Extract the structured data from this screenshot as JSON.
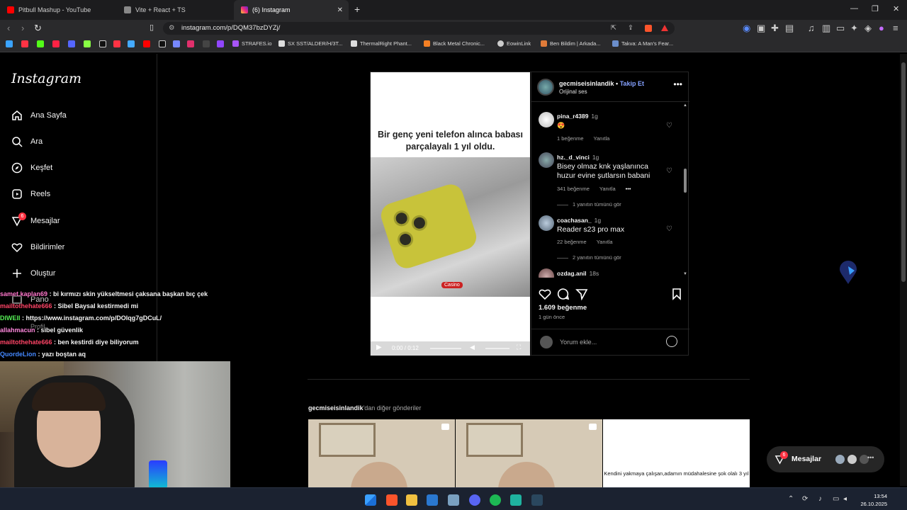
{
  "browser": {
    "tabs": [
      {
        "label": "Pitbull Mashup - YouTube",
        "color": "#ff0000"
      },
      {
        "label": "Vite + React + TS",
        "color": "#888888"
      },
      {
        "label": "(6) Instagram",
        "color": "#e1306c"
      }
    ],
    "new_tab": "+",
    "url": "instagram.com/p/DQM37bzDYZj/",
    "bookmarks": [
      {
        "label": "STRAFES.io"
      },
      {
        "label": "SX SST/ALDER/H/3T..."
      },
      {
        "label": "ThermalRight Phant..."
      },
      {
        "label": "Black Metal Chronic..."
      },
      {
        "label": "EowinLink"
      },
      {
        "label": "Ben Bildim | Arkada..."
      },
      {
        "label": "Takva: A Man's Fear..."
      }
    ]
  },
  "sidebar": {
    "logo": "Instagram",
    "items": [
      {
        "label": "Ana Sayfa",
        "icon": "home-icon"
      },
      {
        "label": "Ara",
        "icon": "search-icon"
      },
      {
        "label": "Keşfet",
        "icon": "explore-icon"
      },
      {
        "label": "Reels",
        "icon": "reels-icon"
      },
      {
        "label": "Mesajlar",
        "icon": "messenger-icon",
        "badge": "6"
      },
      {
        "label": "Bildirimler",
        "icon": "heart-icon"
      },
      {
        "label": "Oluştur",
        "icon": "plus-icon"
      },
      {
        "label": "Pano",
        "icon": "dashboard-icon"
      },
      {
        "label": "Profil",
        "icon": "profile-icon"
      }
    ]
  },
  "chat": [
    {
      "user": "samet.kaplan69",
      "text": ": bi kırmızı skin yükseltmesi çaksana başkan bıç çek",
      "color": "#ff77cc"
    },
    {
      "user": "mailtothehate666",
      "text": ": Sibel Baysal kestirmedi mi",
      "color": "#ff4466"
    },
    {
      "user": "DIWEII",
      "text": ": https://www.instagram.com/p/DOlqg7gDCuL/",
      "color": "#55ee55"
    },
    {
      "user": "allahmacun",
      "text": ": sibel güvenlik",
      "color": "#ff88dd"
    },
    {
      "user": "mailtothehate666",
      "text": ": ben kestirdi diye biliyorum",
      "color": "#ff4466"
    },
    {
      "user": "QuordeLion",
      "text": ": yazı boştan aq",
      "color": "#4488ff"
    }
  ],
  "post": {
    "caption": "Bir genç yeni telefon alınca babası parçalayalı 1 yıl oldu.",
    "casino_tag": "Casino",
    "video_time": "0:00 / 0:12",
    "username": "gecmiseisinlandik",
    "separator": " • ",
    "follow": "Takip Et",
    "audio": "Orijinal ses",
    "comments": [
      {
        "user": "pina_r4389",
        "time": "1g",
        "text": "😍",
        "likes": "1 beğenme",
        "reply": "Yanıtla",
        "replies": ""
      },
      {
        "user": "hz._d_vinci",
        "time": "1g",
        "text": "Bisey olmaz knk yaşlanınca huzur evine şutlarsın babani",
        "likes": "341 beğenme",
        "reply": "Yanıtla",
        "replies": "1 yanıtın tümünü gör"
      },
      {
        "user": "coachasan_",
        "time": "1g",
        "text": "Reader s23 pro max",
        "likes": "22 beğenme",
        "reply": "Yanıtla",
        "replies": "2 yanıtın tümünü gör"
      },
      {
        "user": "ozdag.anil",
        "time": "18s",
        "text": "",
        "likes": "",
        "reply": "",
        "replies": ""
      }
    ],
    "like_count": "1.609 beğenme",
    "date": "1 gün önce",
    "comment_placeholder": "Yorum ekle..."
  },
  "more_posts": {
    "user": "gecmiseisinlandik",
    "suffix": "'dan diğer gönderiler",
    "third_caption": "Kendini yakmaya çalışan,adamın müdahalesine şok olalı 3 yıl"
  },
  "messages_pill": {
    "label": "Mesajlar",
    "badge": "6"
  },
  "taskbar": {
    "time": "13:54",
    "date": "26.10.2025"
  }
}
